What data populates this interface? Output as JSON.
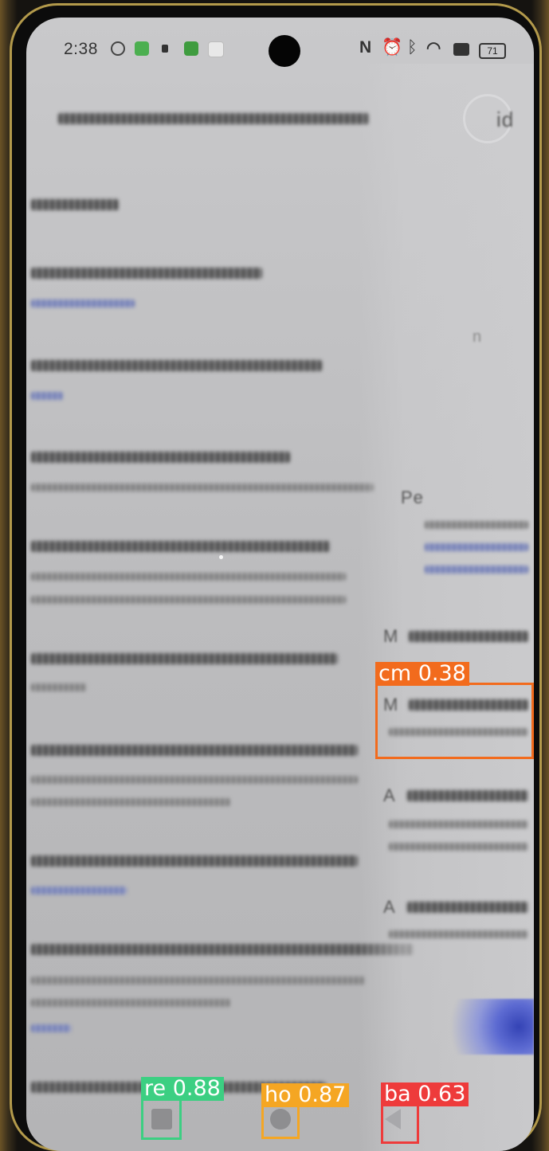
{
  "status_bar": {
    "time": "2:38",
    "nfc_glyph": "N",
    "alarm_glyph": "⏰",
    "bluetooth_glyph": "ᛒ",
    "wifi_glyph": "◠",
    "battery_level": "71"
  },
  "ghost_page": {
    "heading_1": "Pe",
    "heading_2": "M",
    "heading_3": "M",
    "heading_4": "A",
    "heading_5": "A",
    "top_right_fragment": "id",
    "mid_fragment": "n"
  },
  "detections": [
    {
      "label": "cm 0.38",
      "color": "#f26b1d"
    },
    {
      "label": "re 0.88",
      "color": "#3ccf82"
    },
    {
      "label": "ho 0.87",
      "color": "#f5a623"
    },
    {
      "label": "ba 0.63",
      "color": "#ee3b3b"
    }
  ],
  "icons": {
    "recents": "recents-icon",
    "home": "home-icon",
    "back": "back-icon"
  }
}
